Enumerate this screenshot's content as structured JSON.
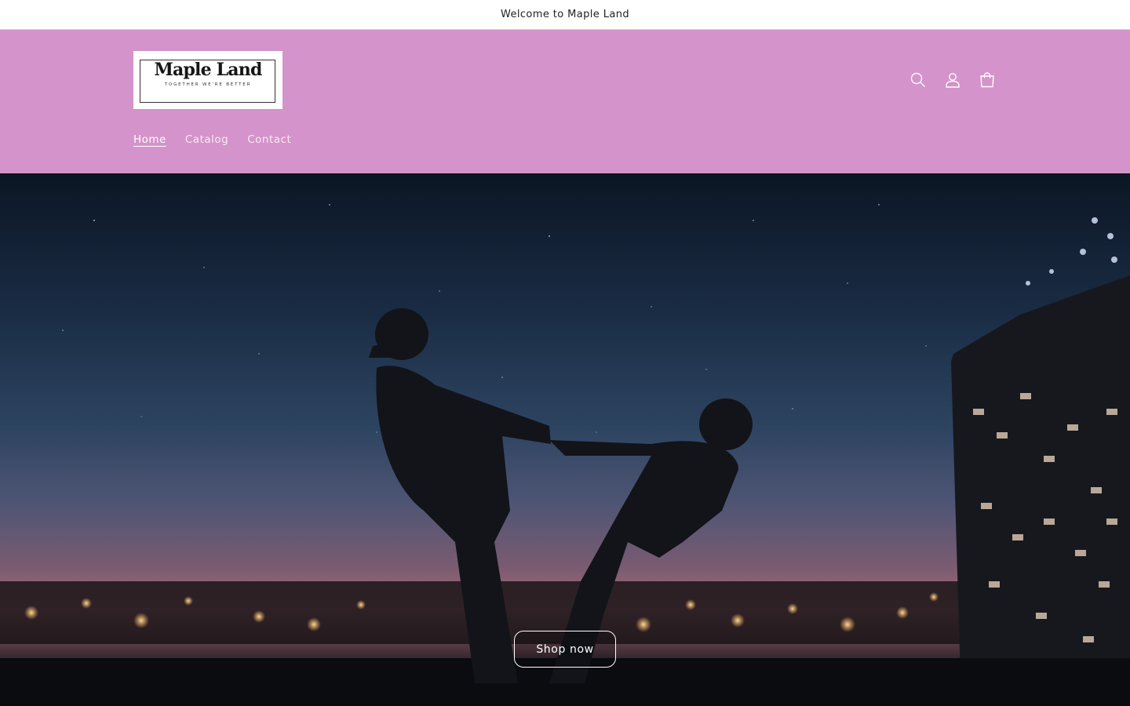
{
  "announcement": {
    "text": "Welcome to Maple Land"
  },
  "header": {
    "logo": {
      "title": "Maple Land",
      "tagline": "TOGETHER WE'RE BETTER"
    },
    "icons": [
      "search-icon",
      "account-icon",
      "cart-icon"
    ],
    "nav": [
      {
        "label": "Home",
        "active": true
      },
      {
        "label": "Catalog",
        "active": false
      },
      {
        "label": "Contact",
        "active": false
      }
    ]
  },
  "hero": {
    "image": "silhouette-couple-night-city",
    "cta_label": "Shop now"
  },
  "colors": {
    "header_bg": "#d493ca",
    "announcement_bg": "#ffffff",
    "text_light": "#ffffff"
  }
}
